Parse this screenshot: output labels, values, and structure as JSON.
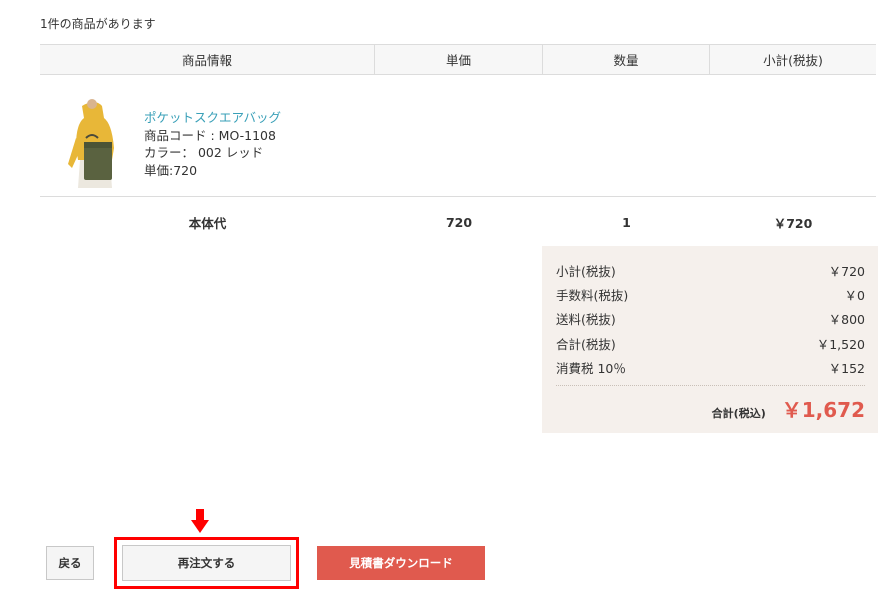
{
  "cart": {
    "item_count_text": "1件の商品があります"
  },
  "table": {
    "headers": {
      "info": "商品情報",
      "price": "単価",
      "qty": "数量",
      "subtotal": "小計(税抜)"
    }
  },
  "product": {
    "name": "ポケットスクエアバッグ",
    "code": "商品コード : MO-1108",
    "color": "カラー： 002 レッド",
    "unit_price": "単価:720"
  },
  "body_row": {
    "label": "本体代",
    "price": "720",
    "qty": "1",
    "subtotal": "￥720"
  },
  "summary": {
    "lines": [
      {
        "label": "小計(税抜)",
        "value": "￥720"
      },
      {
        "label": "手数料(税抜)",
        "value": "￥0"
      },
      {
        "label": "送料(税抜)",
        "value": "￥800"
      },
      {
        "label": "合計(税抜)",
        "value": "￥1,520"
      },
      {
        "label": "消費税 10％",
        "value": "￥152"
      }
    ],
    "total_label": "合計(税込)",
    "total_value": "￥1,672"
  },
  "buttons": {
    "back": "戻る",
    "reorder": "再注文する",
    "download": "見積書ダウンロード"
  },
  "colors": {
    "accent": "#e05a4e",
    "link": "#3aa0b8",
    "summary_bg": "#f5f0ec",
    "highlight": "#ff0000"
  }
}
